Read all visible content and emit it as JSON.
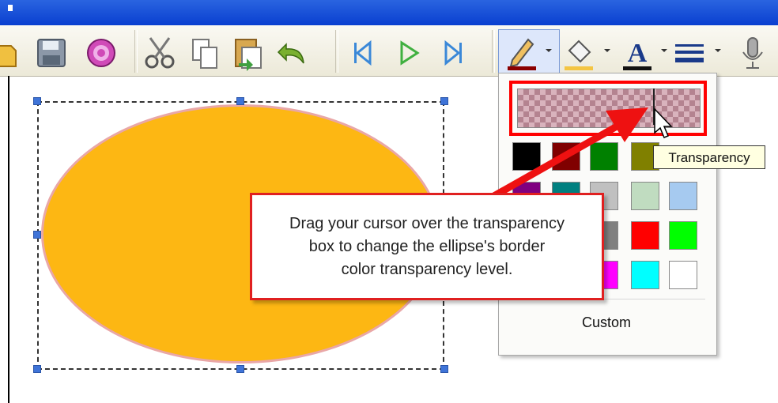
{
  "toolbar": {
    "buttons": [
      {
        "name": "open-icon"
      },
      {
        "name": "save-icon"
      },
      {
        "name": "record-icon"
      },
      {
        "name": "cut-icon"
      },
      {
        "name": "copy-icon"
      },
      {
        "name": "paste-icon"
      },
      {
        "name": "undo-icon"
      },
      {
        "name": "skip-back-icon"
      },
      {
        "name": "play-icon"
      },
      {
        "name": "skip-forward-icon"
      },
      {
        "name": "pen-icon"
      },
      {
        "name": "fill-icon"
      },
      {
        "name": "font-color-icon"
      },
      {
        "name": "line-style-icon"
      },
      {
        "name": "microphone-icon"
      }
    ],
    "pen_color": "#8b0000",
    "fill_color": "#f4c542",
    "font_color_letter": "A"
  },
  "shape": {
    "fill": "#fdb713",
    "border": "#e9a7a7"
  },
  "palette": {
    "swatches": [
      "#000000",
      "#800000",
      "#008000",
      "#808000",
      "#800080",
      "#008080",
      "#c0c0c0",
      "#c0dcc0",
      "#a6caf0",
      "#808080",
      "#ff0000",
      "#00ff00",
      "#ff00ff",
      "#00ffff",
      "#ffffff"
    ],
    "custom_label": "Custom"
  },
  "tooltip": {
    "text": "Transparency"
  },
  "callout": {
    "line1": "Drag your cursor over the transparency",
    "line2": "box to change the ellipse's border",
    "line3": "color transparency level."
  }
}
